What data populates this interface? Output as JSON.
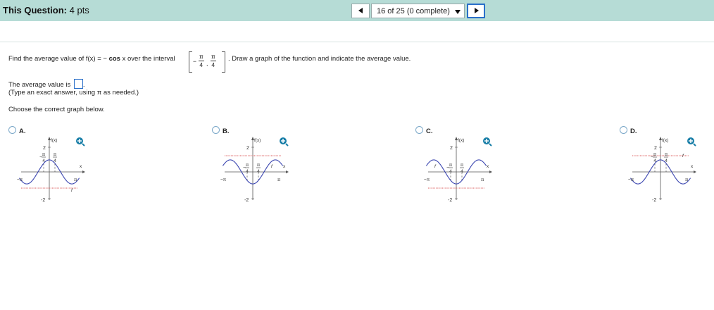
{
  "header": {
    "question_label": "This Question:",
    "points": "4 pts",
    "progress": "16 of 25 (0 complete)"
  },
  "question": {
    "prefix": "Find the average value of f(x) = −",
    "func": "cos",
    "middle": "x over the interval",
    "interval_left_sign": "−",
    "interval_left_num": "π",
    "interval_left_den": "4",
    "interval_right_num": "π",
    "interval_right_den": "4",
    "interval_sep": ",",
    "suffix": ". Draw a graph of the function and indicate the average value.",
    "answer_prompt": "The average value is",
    "answer_end": ".",
    "hint": "(Type an exact answer, using π as needed.)",
    "choose": "Choose the correct graph below."
  },
  "options": [
    {
      "letter": "A.",
      "type": "pos"
    },
    {
      "letter": "B.",
      "type": "neg"
    },
    {
      "letter": "C.",
      "type": "neg2"
    },
    {
      "letter": "D.",
      "type": "pos2"
    }
  ],
  "graph_labels": {
    "fx": "f(x)",
    "x": "x",
    "y_top": "2",
    "y_bottom": "-2",
    "neg_pi": "−π",
    "pi": "π",
    "pi_num": "π",
    "four": "4",
    "minus": "−",
    "f_mark": "f"
  },
  "colors": {
    "header_bg": "#b6dcd6",
    "curve": "#3a45b0",
    "avg_line": "#d02a2a",
    "zoom": "#1a7fa8",
    "answer_border": "#2a6fc9"
  }
}
